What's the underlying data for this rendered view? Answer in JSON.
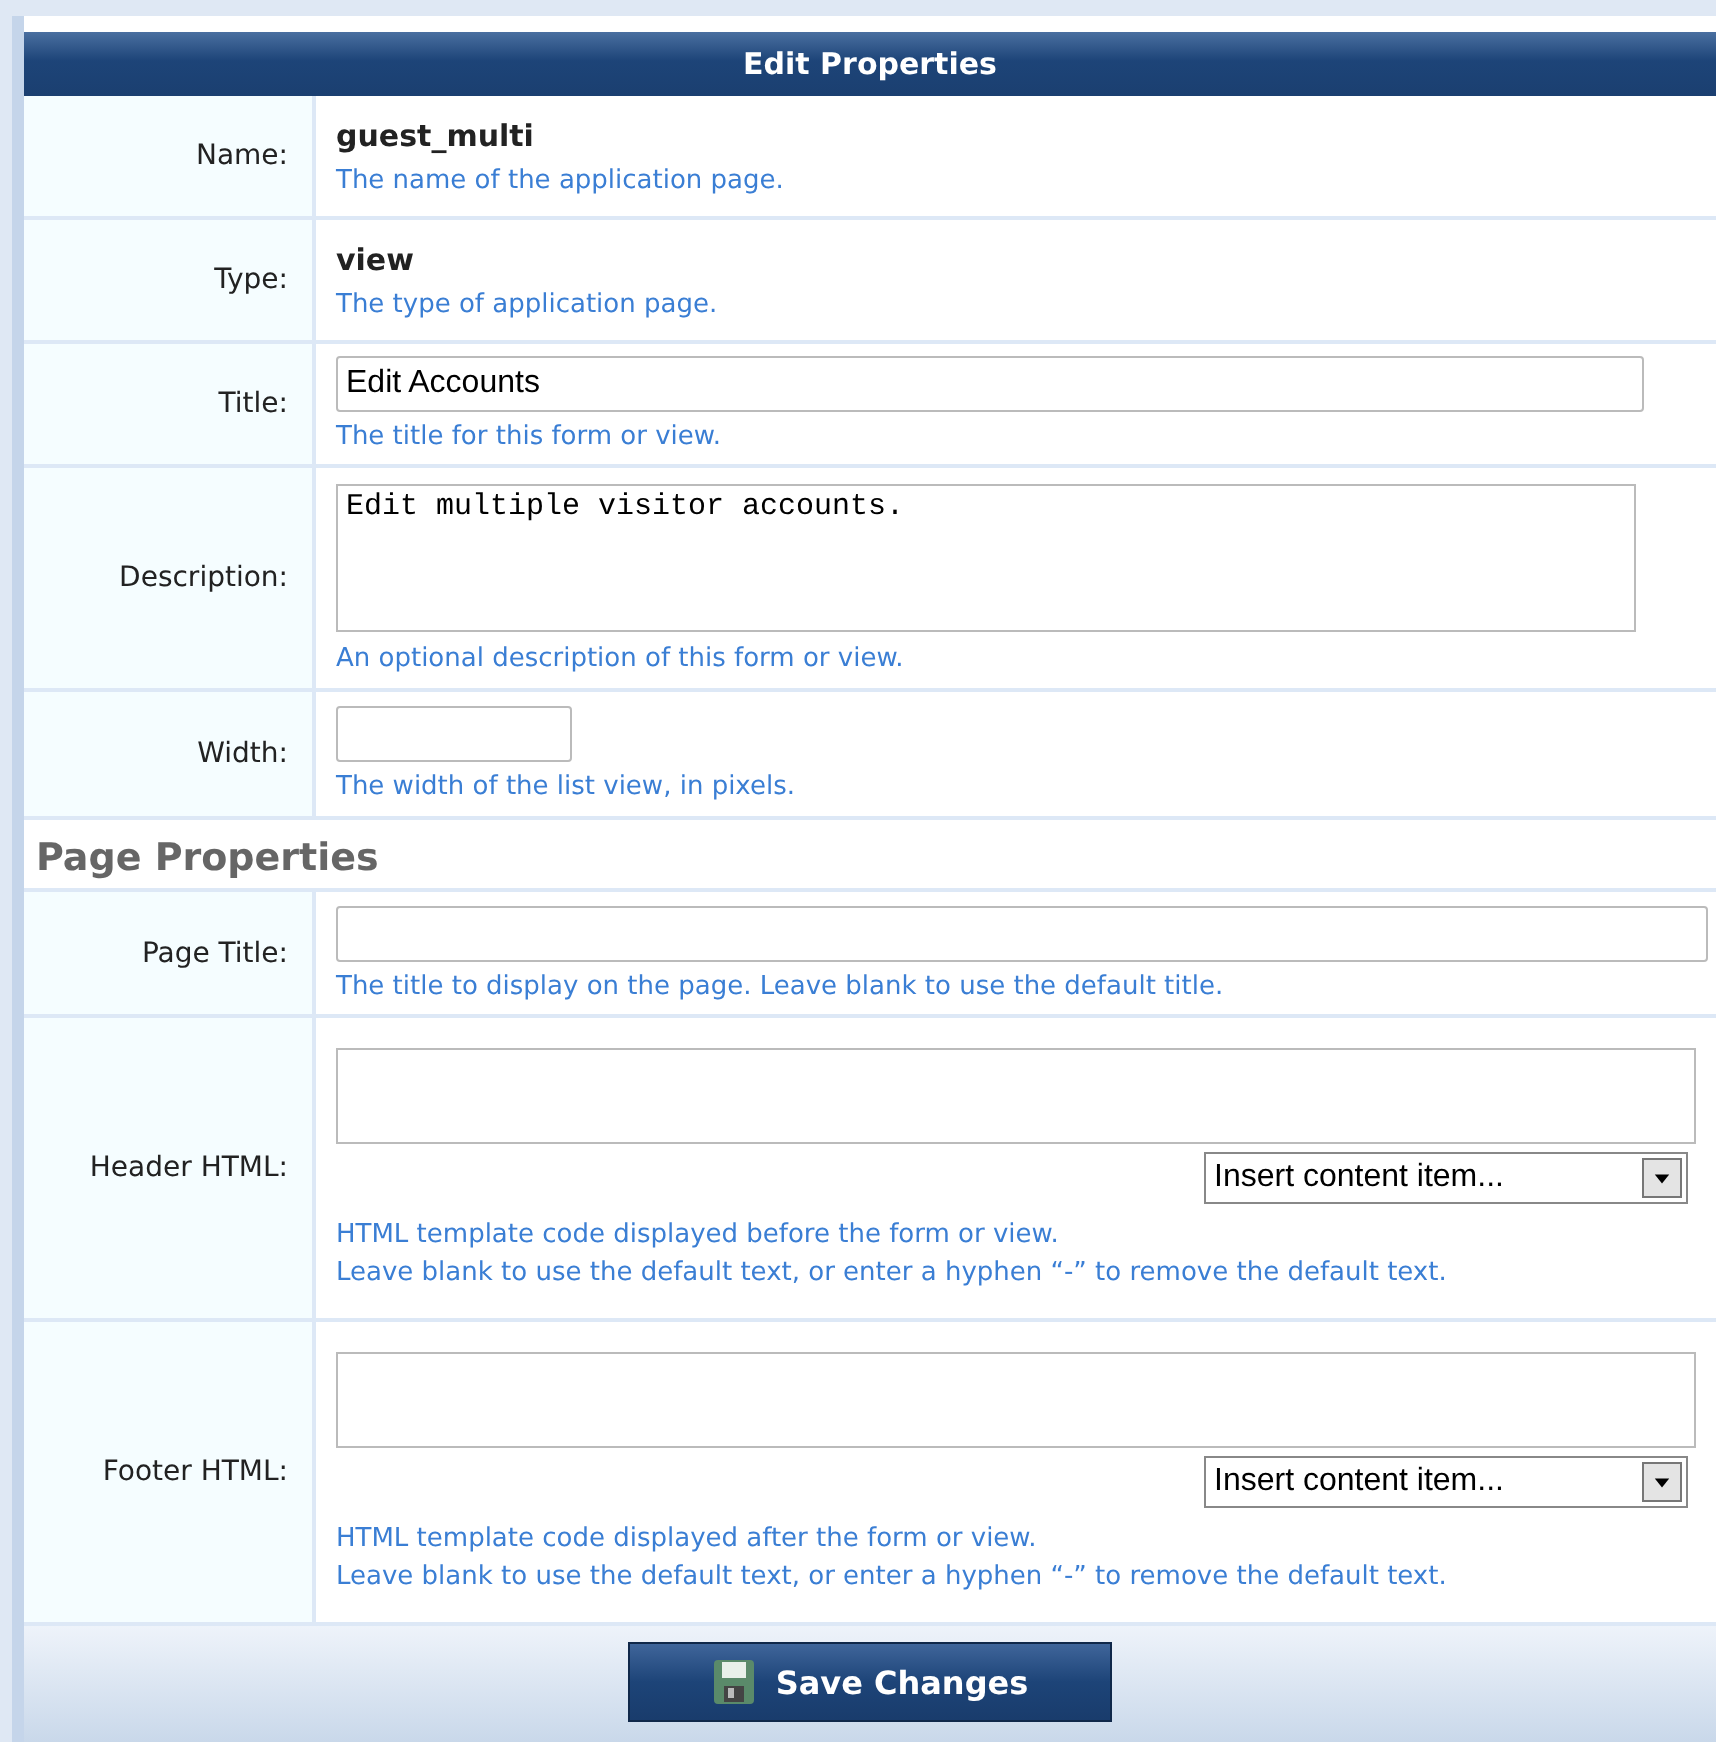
{
  "header": {
    "title": "Edit Properties"
  },
  "sections": [
    {
      "rows": [
        {
          "kind": "static",
          "label": "Name:",
          "value": "guest_multi",
          "hints": [
            "The name of the application page."
          ]
        },
        {
          "kind": "static",
          "label": "Type:",
          "value": "view",
          "hints": [
            "The type of application page."
          ]
        },
        {
          "kind": "text",
          "label": "Title:",
          "value": "Edit Accounts",
          "hints": [
            "The title for this form or view."
          ]
        },
        {
          "kind": "textarea",
          "label": "Description:",
          "value": "Edit multiple visitor accounts.",
          "hints": [
            "An optional description of this form or view."
          ]
        },
        {
          "kind": "short",
          "label": "Width:",
          "hints": [
            "The width of the list view, in pixels."
          ]
        }
      ]
    },
    {
      "heading": "Page Properties",
      "rows": [
        {
          "kind": "wide",
          "label": "Page Title:",
          "hints": [
            "The title to display on the page. Leave blank to use the default title."
          ]
        },
        {
          "kind": "html",
          "label": "Header HTML:",
          "select": "Insert content item...",
          "hints": [
            "HTML template code displayed before the form or view.",
            "Leave blank to use the default text, or enter a hyphen “-” to remove the default text."
          ]
        },
        {
          "kind": "html",
          "label": "Footer HTML:",
          "select": "Insert content item...",
          "hints": [
            "HTML template code displayed after the form or view.",
            "Leave blank to use the default text, or enter a hyphen “-” to remove the default text."
          ]
        }
      ]
    }
  ],
  "save_button": {
    "label": "Save Changes"
  }
}
